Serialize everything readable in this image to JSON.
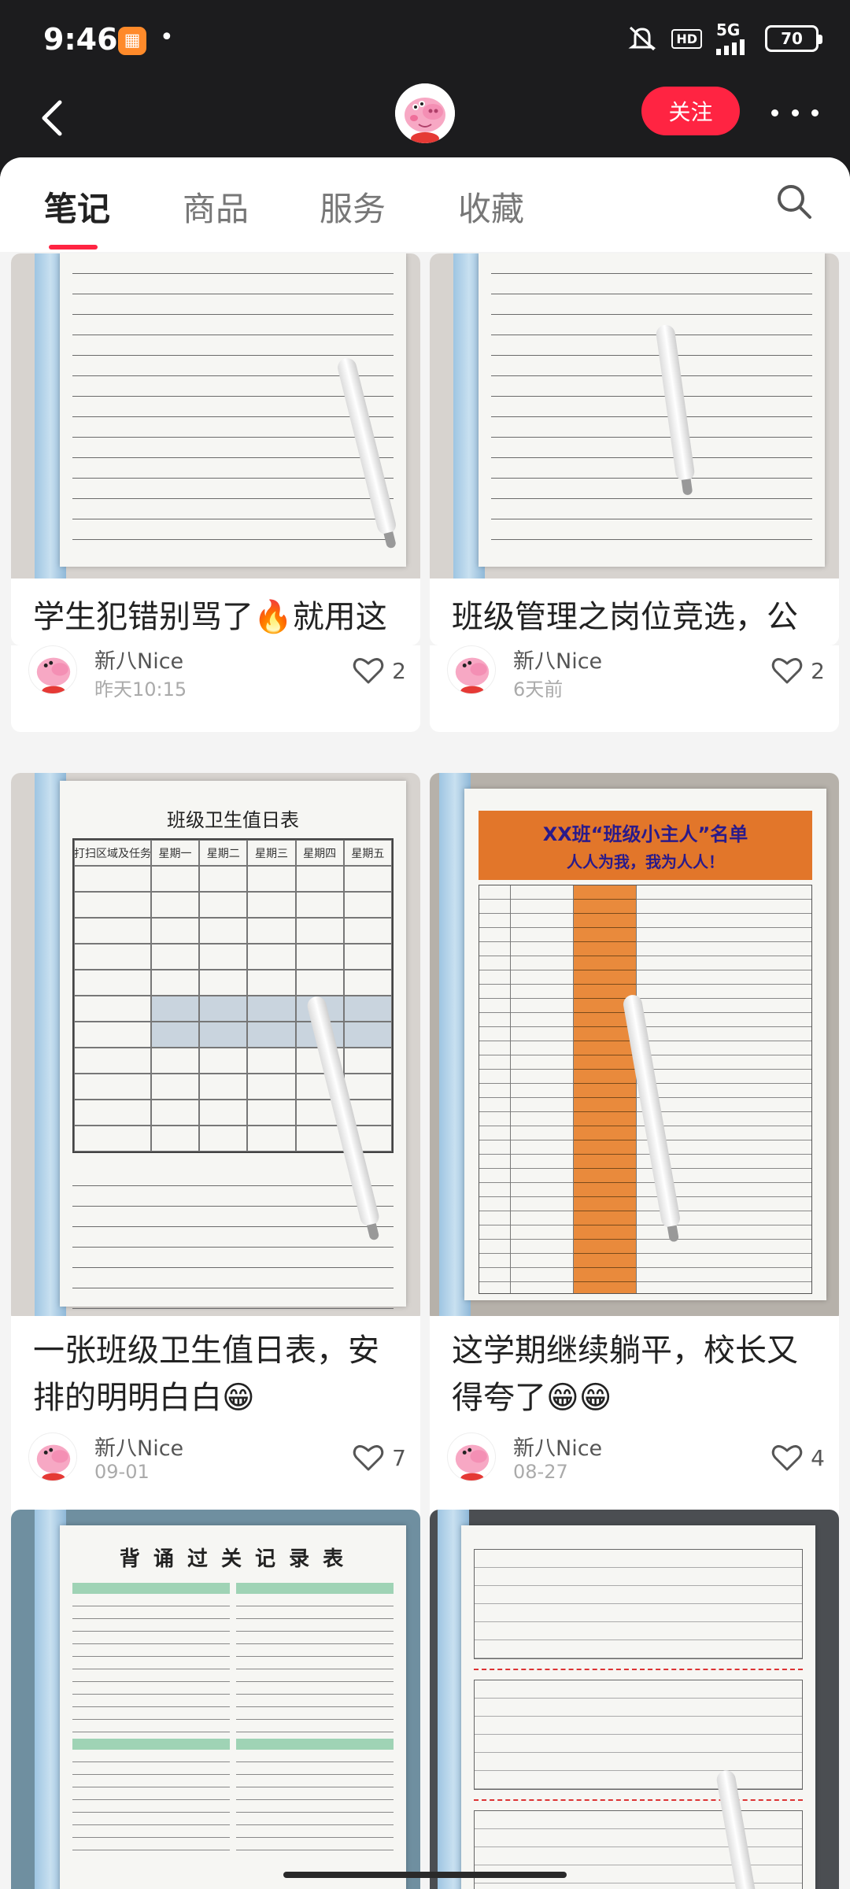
{
  "status_bar": {
    "time": "9:46",
    "dot": "•",
    "hd": "HD",
    "network": "5G",
    "battery": "70"
  },
  "header": {
    "follow_label": "关注"
  },
  "tabs": [
    {
      "label": "笔记"
    },
    {
      "label": "商品"
    },
    {
      "label": "服务"
    },
    {
      "label": "收藏"
    }
  ],
  "notes": [
    {
      "title": "学生犯错别骂了🔥就用这份反思书超管用",
      "author": "新八Nice",
      "time": "昨天10:15",
      "likes": "2"
    },
    {
      "title": "班级管理之岗位竞选，公平竞争透明公开😁",
      "author": "新八Nice",
      "time": "6天前",
      "likes": "2"
    },
    {
      "title": "一张班级卫生值日表，安排的明明白白😁",
      "author": "新八Nice",
      "time": "09-01",
      "likes": "7"
    },
    {
      "title": "这学期继续躺平，校长又得夸了😁😁",
      "author": "新八Nice",
      "time": "08-27",
      "likes": "4"
    }
  ],
  "doc_texts": {
    "duty_title": "班级卫生值日表",
    "duty_days": [
      "打扫区域及任务",
      "星期一",
      "星期二",
      "星期三",
      "星期四",
      "星期五"
    ],
    "helper_title": "XX班“班级小主人”名单",
    "helper_sub": "人人为我，我为人人！",
    "recite_title": "背 诵 过 关 记 录 表"
  },
  "colors": {
    "accent": "#ff2442",
    "orange": "#e2762a"
  }
}
